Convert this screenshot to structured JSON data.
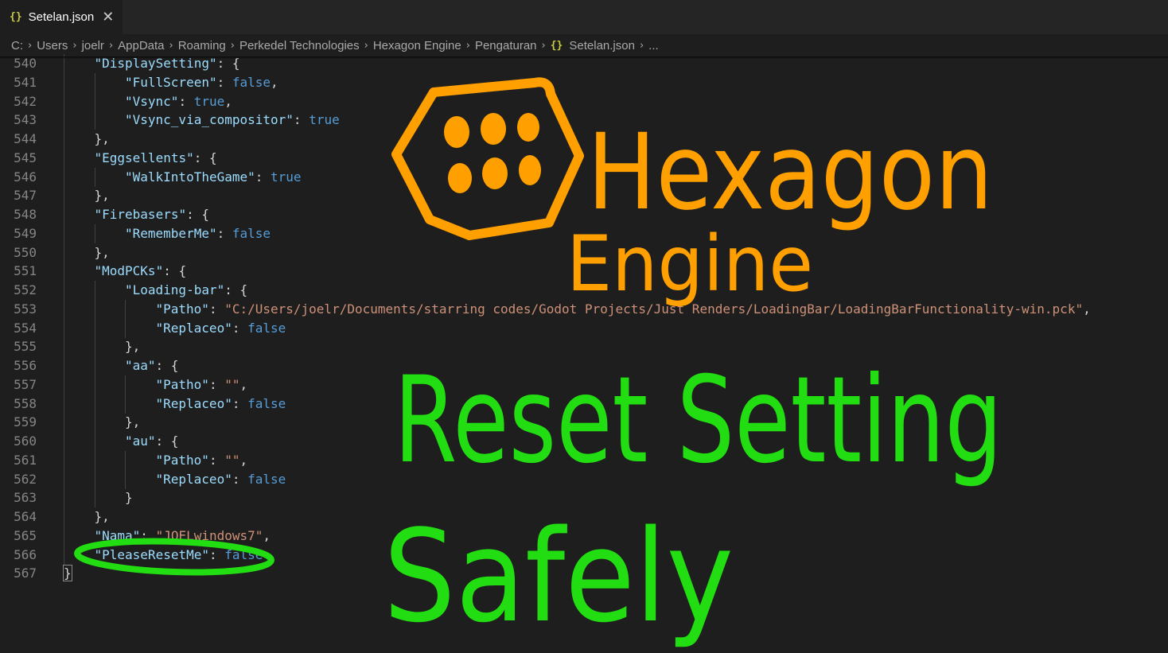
{
  "tab": {
    "icon": "json-braces-icon",
    "icon_glyph": "{}",
    "title": "Setelan.json",
    "close_glyph": "✕"
  },
  "breadcrumb": {
    "items": [
      "C:",
      "Users",
      "joelr",
      "AppData",
      "Roaming",
      "Perkedel Technologies",
      "Hexagon Engine",
      "Pengaturan"
    ],
    "file_icon_glyph": "{}",
    "file": "Setelan.json",
    "trailing": "...",
    "separator": "›"
  },
  "editor": {
    "lines": [
      {
        "n": "540",
        "indent": 1,
        "t": [
          [
            "k",
            "\"DisplaySetting\""
          ],
          [
            "p",
            ": {"
          ]
        ]
      },
      {
        "n": "541",
        "indent": 2,
        "t": [
          [
            "k",
            "\"FullScreen\""
          ],
          [
            "p",
            ": "
          ],
          [
            "b",
            "false"
          ],
          [
            "p",
            ","
          ]
        ]
      },
      {
        "n": "542",
        "indent": 2,
        "t": [
          [
            "k",
            "\"Vsync\""
          ],
          [
            "p",
            ": "
          ],
          [
            "b",
            "true"
          ],
          [
            "p",
            ","
          ]
        ]
      },
      {
        "n": "543",
        "indent": 2,
        "t": [
          [
            "k",
            "\"Vsync_via_compositor\""
          ],
          [
            "p",
            ": "
          ],
          [
            "b",
            "true"
          ]
        ]
      },
      {
        "n": "544",
        "indent": 1,
        "t": [
          [
            "p",
            "},"
          ]
        ]
      },
      {
        "n": "545",
        "indent": 1,
        "t": [
          [
            "k",
            "\"Eggsellents\""
          ],
          [
            "p",
            ": {"
          ]
        ]
      },
      {
        "n": "546",
        "indent": 2,
        "t": [
          [
            "k",
            "\"WalkIntoTheGame\""
          ],
          [
            "p",
            ": "
          ],
          [
            "b",
            "true"
          ]
        ]
      },
      {
        "n": "547",
        "indent": 1,
        "t": [
          [
            "p",
            "},"
          ]
        ]
      },
      {
        "n": "548",
        "indent": 1,
        "t": [
          [
            "k",
            "\"Firebasers\""
          ],
          [
            "p",
            ": {"
          ]
        ]
      },
      {
        "n": "549",
        "indent": 2,
        "t": [
          [
            "k",
            "\"RememberMe\""
          ],
          [
            "p",
            ": "
          ],
          [
            "b",
            "false"
          ]
        ]
      },
      {
        "n": "550",
        "indent": 1,
        "t": [
          [
            "p",
            "},"
          ]
        ]
      },
      {
        "n": "551",
        "indent": 1,
        "t": [
          [
            "k",
            "\"ModPCKs\""
          ],
          [
            "p",
            ": {"
          ]
        ]
      },
      {
        "n": "552",
        "indent": 2,
        "t": [
          [
            "k",
            "\"Loading-bar\""
          ],
          [
            "p",
            ": {"
          ]
        ]
      },
      {
        "n": "553",
        "indent": 3,
        "t": [
          [
            "k",
            "\"Patho\""
          ],
          [
            "p",
            ": "
          ],
          [
            "s",
            "\"C:/Users/joelr/Documents/starring codes/Godot Projects/Just Renders/LoadingBar/LoadingBarFunctionality-win.pck\""
          ],
          [
            "p",
            ","
          ]
        ]
      },
      {
        "n": "554",
        "indent": 3,
        "t": [
          [
            "k",
            "\"Replaceo\""
          ],
          [
            "p",
            ": "
          ],
          [
            "b",
            "false"
          ]
        ]
      },
      {
        "n": "555",
        "indent": 2,
        "t": [
          [
            "p",
            "},"
          ]
        ]
      },
      {
        "n": "556",
        "indent": 2,
        "t": [
          [
            "k",
            "\"aa\""
          ],
          [
            "p",
            ": {"
          ]
        ]
      },
      {
        "n": "557",
        "indent": 3,
        "t": [
          [
            "k",
            "\"Patho\""
          ],
          [
            "p",
            ": "
          ],
          [
            "s",
            "\"\""
          ],
          [
            "p",
            ","
          ]
        ]
      },
      {
        "n": "558",
        "indent": 3,
        "t": [
          [
            "k",
            "\"Replaceo\""
          ],
          [
            "p",
            ": "
          ],
          [
            "b",
            "false"
          ]
        ]
      },
      {
        "n": "559",
        "indent": 2,
        "t": [
          [
            "p",
            "},"
          ]
        ]
      },
      {
        "n": "560",
        "indent": 2,
        "t": [
          [
            "k",
            "\"au\""
          ],
          [
            "p",
            ": {"
          ]
        ]
      },
      {
        "n": "561",
        "indent": 3,
        "t": [
          [
            "k",
            "\"Patho\""
          ],
          [
            "p",
            ": "
          ],
          [
            "s",
            "\"\""
          ],
          [
            "p",
            ","
          ]
        ]
      },
      {
        "n": "562",
        "indent": 3,
        "t": [
          [
            "k",
            "\"Replaceo\""
          ],
          [
            "p",
            ": "
          ],
          [
            "b",
            "false"
          ]
        ]
      },
      {
        "n": "563",
        "indent": 2,
        "t": [
          [
            "p",
            "}"
          ]
        ]
      },
      {
        "n": "564",
        "indent": 1,
        "t": [
          [
            "p",
            "},"
          ]
        ]
      },
      {
        "n": "565",
        "indent": 1,
        "t": [
          [
            "k",
            "\"Nama\""
          ],
          [
            "p",
            ": "
          ],
          [
            "s",
            "\"JOELwindows7\""
          ],
          [
            "p",
            ","
          ]
        ]
      },
      {
        "n": "566",
        "indent": 1,
        "t": [
          [
            "k",
            "\"PleaseResetMe\""
          ],
          [
            "p",
            ": "
          ],
          [
            "b",
            "false"
          ]
        ]
      },
      {
        "n": "567",
        "indent": 0,
        "t": [
          [
            "p",
            "}"
          ]
        ]
      }
    ]
  },
  "overlay": {
    "logo": "hexagon-engine-logo",
    "logo_text_1": "Hexagon",
    "logo_text_2": "Engine",
    "caption_1": "Reset Setting",
    "caption_2": "Safely",
    "colors": {
      "logo": "#ffa000",
      "caption": "#22dd11"
    }
  },
  "colors": {
    "key": "#9cdcfe",
    "string": "#ce9178",
    "keyword": "#569cd6",
    "punct": "#d4d4d4",
    "line_number": "#858585",
    "background": "#1e1e1e"
  }
}
